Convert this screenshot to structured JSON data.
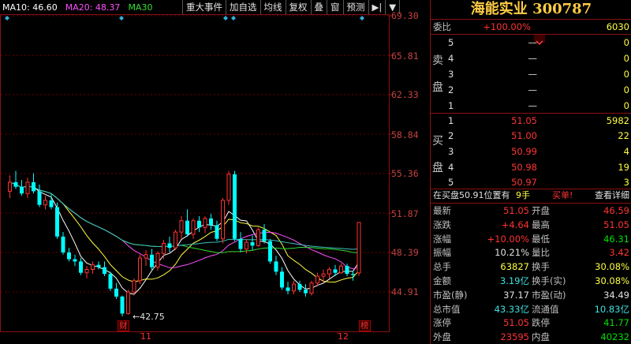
{
  "stock": {
    "name": "海能实业",
    "code": "300787"
  },
  "ma_legend": [
    {
      "label": "MA10: 46.60",
      "color": "#ffffff"
    },
    {
      "label": "MA20: 48.37",
      "color": "#ff50ff"
    },
    {
      "label": "MA30",
      "color": "#30e030"
    }
  ],
  "toolbar": [
    "重大事件",
    "加自选",
    "均线",
    "复权",
    "叠",
    "窗",
    "预测",
    "▶|",
    "▼"
  ],
  "price_axis": [
    "69.30",
    "65.81",
    "62.33",
    "58.84",
    "55.36",
    "51.87",
    "48.39",
    "44.91"
  ],
  "date_axis": [
    "11",
    "12"
  ],
  "tags": {
    "cai": "财",
    "bang": "榜"
  },
  "low_label": "42.75",
  "committee": {
    "label": "委比",
    "ratio": "+100.00%",
    "diff": "6030"
  },
  "sell_label": [
    "卖",
    "盘"
  ],
  "buy_label": [
    "买",
    "盘"
  ],
  "asks": [
    {
      "level": "5",
      "price": "—",
      "vol": "0"
    },
    {
      "level": "4",
      "price": "—",
      "vol": "0"
    },
    {
      "level": "3",
      "price": "—",
      "vol": "0"
    },
    {
      "level": "2",
      "price": "—",
      "vol": "0"
    },
    {
      "level": "1",
      "price": "—",
      "vol": "0"
    }
  ],
  "bids": [
    {
      "level": "1",
      "price": "51.05",
      "vol": "5982"
    },
    {
      "level": "2",
      "price": "51.00",
      "vol": "22"
    },
    {
      "level": "3",
      "price": "50.99",
      "vol": "4"
    },
    {
      "level": "4",
      "price": "50.98",
      "vol": "19"
    },
    {
      "level": "5",
      "price": "50.97",
      "vol": "3"
    }
  ],
  "queue": {
    "text": "在买盘50.91位置有",
    "hands": "9手",
    "action": "买单!",
    "detail": "查看详细"
  },
  "quotes": [
    {
      "l": "最新",
      "lv": "51.05",
      "lc": "red",
      "r": "开盘",
      "rv": "46.59",
      "rc": "red"
    },
    {
      "l": "涨跌",
      "lv": "+4.64",
      "lc": "red",
      "r": "最高",
      "rv": "51.05",
      "rc": "red"
    },
    {
      "l": "涨幅",
      "lv": "+10.00%",
      "lc": "red",
      "r": "最低",
      "rv": "46.31",
      "rc": "green"
    },
    {
      "l": "振幅",
      "lv": "10.21%",
      "lc": "white",
      "r": "量比",
      "rv": "3.42",
      "rc": "red"
    },
    {
      "l": "总手",
      "lv": "63827",
      "lc": "yellow",
      "r": "换手",
      "rv": "30.08%",
      "rc": "yellow"
    },
    {
      "l": "金额",
      "lv": "3.19亿",
      "lc": "cyan",
      "r": "换手(实)",
      "rv": "30.08%",
      "rc": "yellow"
    },
    {
      "l": "市盈(静)",
      "lv": "37.17",
      "lc": "white",
      "r": "市盈(动)",
      "rv": "34.49",
      "rc": "white"
    },
    {
      "l": "总市值",
      "lv": "43.33亿",
      "lc": "cyan",
      "r": "流通值",
      "rv": "10.83亿",
      "rc": "cyan"
    },
    {
      "l": "涨停",
      "lv": "51.05",
      "lc": "red",
      "r": "跌停",
      "rv": "41.77",
      "rc": "green"
    },
    {
      "l": "外盘",
      "lv": "23595",
      "lc": "red",
      "r": "内盘",
      "rv": "40232",
      "rc": "green"
    }
  ],
  "colors": {
    "up": "#ff3333",
    "down": "#00ffff",
    "border": "#8a1010"
  },
  "candles": [
    [
      53.8,
      55.2,
      53.2,
      54.6
    ],
    [
      54.6,
      55.6,
      54.0,
      54.2
    ],
    [
      54.2,
      54.8,
      53.4,
      53.6
    ],
    [
      53.6,
      55.0,
      53.2,
      54.6
    ],
    [
      54.6,
      55.4,
      53.6,
      53.8
    ],
    [
      53.8,
      54.4,
      52.4,
      52.6
    ],
    [
      52.6,
      53.4,
      52.2,
      53.0
    ],
    [
      53.0,
      53.6,
      52.2,
      52.4
    ],
    [
      52.4,
      52.8,
      49.6,
      49.8
    ],
    [
      49.8,
      50.2,
      48.2,
      48.4
    ],
    [
      48.4,
      48.8,
      47.6,
      47.8
    ],
    [
      47.8,
      48.2,
      47.2,
      47.6
    ],
    [
      47.6,
      47.9,
      46.4,
      46.6
    ],
    [
      46.6,
      47.2,
      46.1,
      46.9
    ],
    [
      46.9,
      47.6,
      46.5,
      47.3
    ],
    [
      47.3,
      47.6,
      46.9,
      47.1
    ],
    [
      47.1,
      47.6,
      46.3,
      46.5
    ],
    [
      46.5,
      46.7,
      45.0,
      45.2
    ],
    [
      45.2,
      45.7,
      44.3,
      44.5
    ],
    [
      44.5,
      44.6,
      42.75,
      43.0
    ],
    [
      43.0,
      45.1,
      42.9,
      44.9
    ],
    [
      44.9,
      46.1,
      44.6,
      45.9
    ],
    [
      45.9,
      48.2,
      45.6,
      47.9
    ],
    [
      47.9,
      48.6,
      47.2,
      48.2
    ],
    [
      48.2,
      48.7,
      46.9,
      47.1
    ],
    [
      47.1,
      48.5,
      46.8,
      48.3
    ],
    [
      48.3,
      49.5,
      47.8,
      49.2
    ],
    [
      49.2,
      49.8,
      48.4,
      48.8
    ],
    [
      48.8,
      50.4,
      48.6,
      50.2
    ],
    [
      50.2,
      51.6,
      49.6,
      51.2
    ],
    [
      51.2,
      52.2,
      49.8,
      50.0
    ],
    [
      50.0,
      51.4,
      49.6,
      51.2
    ],
    [
      51.2,
      51.6,
      50.2,
      50.6
    ],
    [
      50.6,
      51.6,
      50.1,
      51.4
    ],
    [
      51.4,
      51.8,
      50.4,
      50.8
    ],
    [
      50.8,
      51.2,
      49.4,
      49.6
    ],
    [
      49.6,
      53.2,
      49.2,
      53.0
    ],
    [
      53.0,
      55.6,
      52.6,
      55.3
    ],
    [
      55.3,
      55.6,
      49.4,
      49.6
    ],
    [
      49.6,
      50.2,
      48.4,
      48.7
    ],
    [
      48.7,
      49.6,
      48.3,
      49.3
    ],
    [
      49.3,
      49.9,
      48.6,
      49.0
    ],
    [
      49.0,
      50.6,
      48.9,
      50.4
    ],
    [
      50.4,
      50.9,
      49.2,
      49.4
    ],
    [
      49.4,
      49.6,
      47.4,
      47.6
    ],
    [
      47.6,
      48.1,
      46.4,
      46.7
    ],
    [
      46.7,
      47.1,
      45.1,
      45.3
    ],
    [
      45.3,
      45.8,
      44.7,
      45.0
    ],
    [
      45.0,
      45.9,
      44.7,
      45.6
    ],
    [
      45.6,
      45.9,
      44.9,
      45.1
    ],
    [
      45.1,
      45.6,
      44.5,
      44.8
    ],
    [
      44.8,
      45.9,
      44.6,
      45.7
    ],
    [
      45.7,
      46.6,
      45.4,
      46.3
    ],
    [
      46.3,
      46.9,
      45.7,
      46.5
    ],
    [
      46.5,
      47.1,
      46.1,
      46.9
    ],
    [
      46.9,
      47.3,
      46.3,
      46.6
    ],
    [
      46.6,
      47.4,
      46.5,
      47.2
    ],
    [
      47.2,
      47.4,
      46.3,
      46.5
    ],
    [
      46.5,
      46.8,
      45.9,
      46.41
    ],
    [
      46.59,
      51.05,
      46.31,
      51.05
    ]
  ]
}
